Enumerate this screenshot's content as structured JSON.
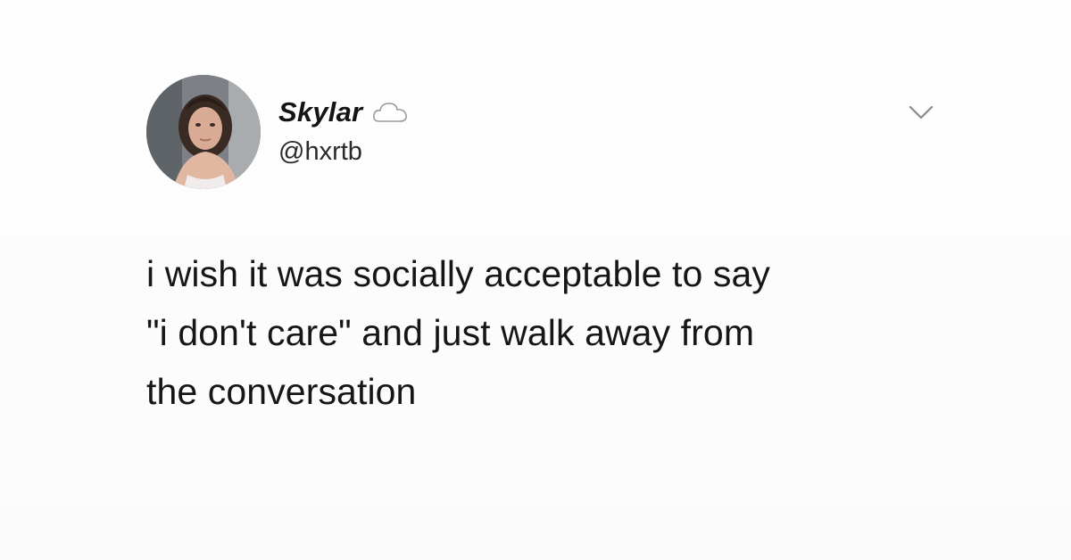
{
  "author": {
    "display_name": "Skylar",
    "handle": "@hxrtb",
    "badge_icon": "cloud-icon",
    "avatar_icon": "profile-photo"
  },
  "menu": {
    "icon": "chevron-down-icon"
  },
  "tweet": {
    "lines": [
      "i wish it was socially acceptable to say",
      "\"i don't care\" and just walk away from",
      "the conversation"
    ]
  },
  "colors": {
    "background": "#ffffff",
    "text": "#161616",
    "icon": "#8a8a8a"
  }
}
